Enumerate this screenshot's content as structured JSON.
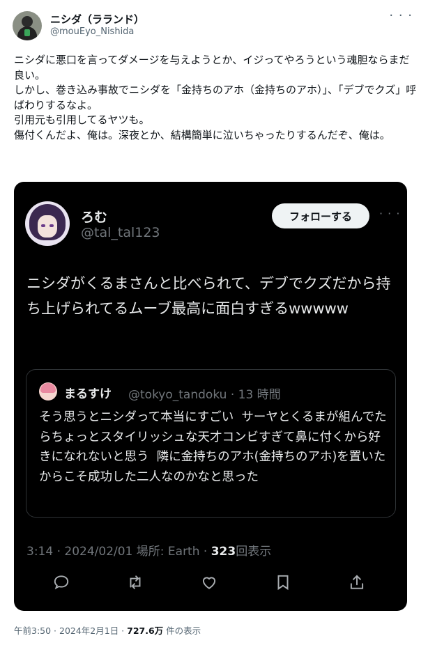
{
  "author": {
    "name": "ニシダ（ラランド）",
    "handle": "@mouEyo_Nishida"
  },
  "tweet_text": "ニシダに悪口を言ってダメージを与えようとか、イジってやろうという魂胆ならまだ良い。\nしかし、巻き込み事故でニシダを「金持ちのアホ（金持ちのアホ）」、「デブでクズ」呼ばわりするなよ。\n引用元も引用してるヤツも。\n傷付くんだよ、俺は。深夜とか、結構簡単に泣いちゃったりするんだぞ、俺は。",
  "quoted": {
    "name": "ろむ",
    "handle": "@tal_tal123",
    "follow_label": "フォローする",
    "text": "ニシダがくるまさんと比べられて、デブでクズだから持ち上げられてるムーブ最高に面白すぎるwwwww",
    "inner": {
      "name": "まるすけ",
      "meta": "@tokyo_tandoku · 13 時間",
      "text": "そう思うとニシダって本当にすごい  サーヤとくるまが組んでたらちょっとスタイリッシュな天才コンビすぎて鼻に付くから好きになれないと思う  隣に金持ちのアホ(金持ちのアホ)を置いたからこそ成功した二人なのかなと思った"
    },
    "footer": {
      "meta": "3:14 · 2024/02/01 場所: Earth · ",
      "views": "323",
      "views_label": "回表示"
    }
  },
  "footer": {
    "meta": "午前3:50 · 2024年2月1日 · ",
    "views": "727.6万",
    "views_label": " 件の表示"
  },
  "icons": [
    "more-icon",
    "reply-icon",
    "retweet-icon",
    "like-icon",
    "bookmark-icon",
    "share-icon"
  ],
  "colors": {
    "card_bg": "#000000",
    "muted": "#71767b",
    "text_dark": "#e7e9ea"
  }
}
